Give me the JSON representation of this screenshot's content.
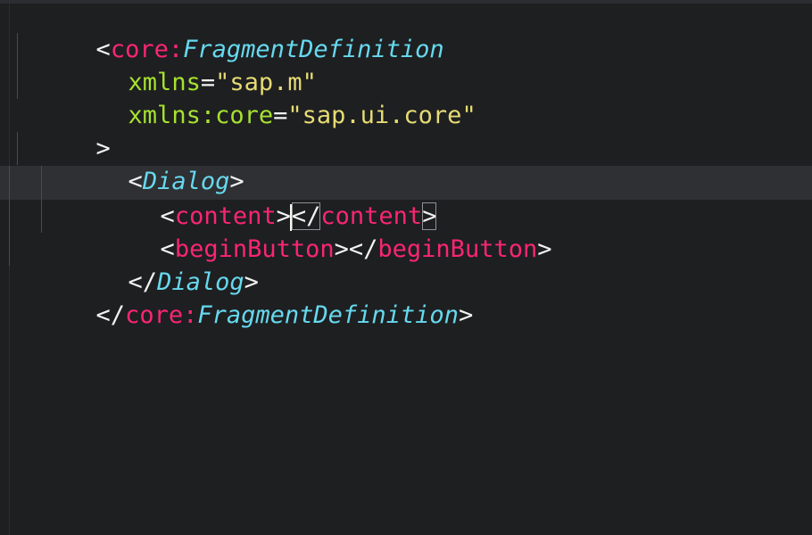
{
  "editor": {
    "language": "xml",
    "theme_colors": {
      "background": "#1e1f21",
      "current_line": "#2f3033",
      "punctuation": "#f2f2f2",
      "namespace": "#f92672",
      "tag_name": "#66d9ef",
      "element_name": "#f92672",
      "attribute": "#a6e22e",
      "string": "#e6db74"
    },
    "lines": [
      {
        "t1": "<",
        "t2": "core:",
        "t3": "FragmentDefinition"
      },
      {
        "a1": "xmlns",
        "a2": "=",
        "a3": "\"sap.m\""
      },
      {
        "a1": "xmlns:core",
        "a2": "=",
        "a3": "\"sap.ui.core\""
      },
      {
        "t1": ">"
      },
      {
        "t1": "<",
        "t2": "Dialog",
        "t3": ">"
      },
      {
        "t1": "<",
        "t2": "content",
        "t3": ">",
        "t4": "</",
        "t5": "content",
        "t6": ">"
      },
      {
        "t1": "<",
        "t2": "beginButton",
        "t3": ">",
        "t4": "</",
        "t5": "beginButton",
        "t6": ">"
      },
      {
        "t1": "</",
        "t2": "Dialog",
        "t3": ">"
      },
      {
        "t1": "</",
        "t2": "core:",
        "t3": "FragmentDefinition",
        "t4": ">"
      }
    ]
  }
}
